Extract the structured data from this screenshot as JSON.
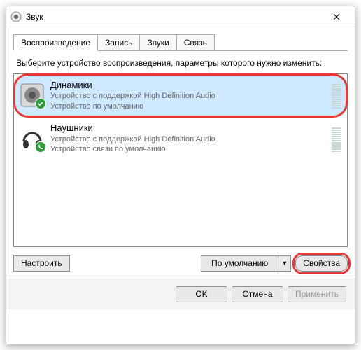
{
  "window": {
    "title": "Звук"
  },
  "tabs": {
    "playback": "Воспроизведение",
    "recording": "Запись",
    "sounds": "Звуки",
    "communication": "Связь"
  },
  "instruction": "Выберите устройство воспроизведения, параметры которого нужно изменить:",
  "devices": [
    {
      "title": "Динамики",
      "line1": "Устройство с поддержкой High Definition Audio",
      "line2": "Устройство по умолчанию",
      "selected": true,
      "badge": "check"
    },
    {
      "title": "Наушники",
      "line1": "Устройство с поддержкой High Definition Audio",
      "line2": "Устройство связи по умолчанию",
      "selected": false,
      "badge": "phone"
    }
  ],
  "buttons": {
    "configure": "Настроить",
    "default": "По умолчанию",
    "properties": "Свойства",
    "ok": "OK",
    "cancel": "Отмена",
    "apply": "Применить"
  }
}
